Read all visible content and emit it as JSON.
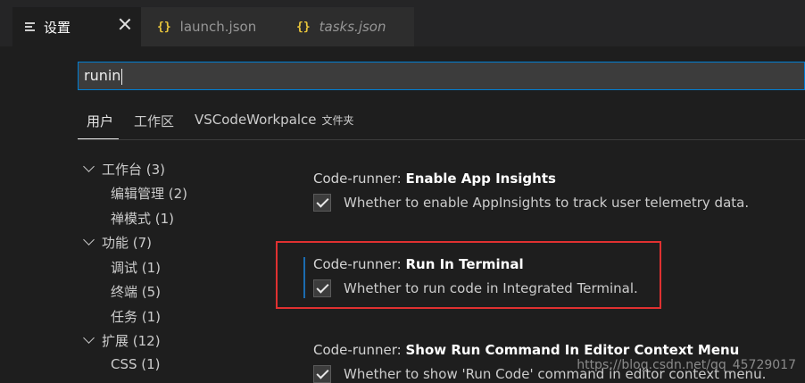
{
  "tabs": [
    {
      "label": "设置",
      "icon": "settings-lines-icon",
      "active": true
    },
    {
      "label": "launch.json",
      "icon": "json-braces-icon",
      "italic": false
    },
    {
      "label": "tasks.json",
      "icon": "json-braces-icon",
      "italic": true
    }
  ],
  "braces_glyph": "{}",
  "search": {
    "value": "runin"
  },
  "scopes": {
    "user": "用户",
    "workspace": "工作区",
    "folder": "VSCodeWorkpalce",
    "folder_suffix": "文件夹"
  },
  "tree": [
    {
      "label": "工作台 (3)",
      "expanded": true,
      "level": 0
    },
    {
      "label": "编辑管理 (2)",
      "level": 1
    },
    {
      "label": "禅模式 (1)",
      "level": 1
    },
    {
      "label": "功能 (7)",
      "expanded": true,
      "level": 0
    },
    {
      "label": "调试 (1)",
      "level": 1
    },
    {
      "label": "终端 (5)",
      "level": 1
    },
    {
      "label": "任务 (1)",
      "level": 1
    },
    {
      "label": "扩展 (12)",
      "expanded": true,
      "level": 0
    },
    {
      "label": "CSS (1)",
      "level": 1
    }
  ],
  "settings": [
    {
      "prefix": "Code-runner: ",
      "name": "Enable App Insights",
      "description": "Whether to enable AppInsights to track user telemetry data.",
      "checked": true
    },
    {
      "prefix": "Code-runner: ",
      "name": "Run In Terminal",
      "description": "Whether to run code in Integrated Terminal.",
      "checked": true
    },
    {
      "prefix": "Code-runner: ",
      "name": "Show Run Command In Editor Context Menu",
      "description": "Whether to show 'Run Code' command in editor context menu.",
      "checked": true
    }
  ],
  "watermark": "https://blog.csdn.net/qq_45729017",
  "colors": {
    "accent": "#007fd4",
    "highlight": "#e03131",
    "braces": "#e8c53b"
  }
}
